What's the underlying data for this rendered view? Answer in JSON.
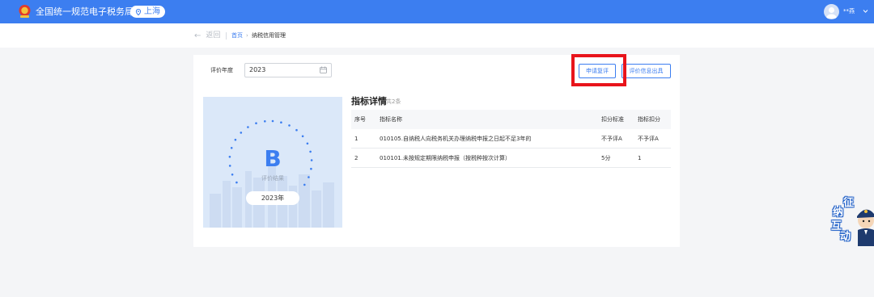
{
  "header": {
    "site_title": "全国统一规范电子税务局",
    "region": "上海",
    "user_name": "**燕",
    "brand_color": "#3c7ef0"
  },
  "breadcrumb": {
    "back_label": "返回",
    "home_label": "首页",
    "separator": "›",
    "current_label": "纳税信用管理"
  },
  "filter": {
    "year_label": "评价年度",
    "year_value": "2023"
  },
  "actions": {
    "apply_label": "申请复评",
    "issue_label": "评价信息出具",
    "highlight_color": "#e8141b"
  },
  "result": {
    "grade": "B",
    "grade_label": "评价结果",
    "year_pill": "2023年"
  },
  "details": {
    "title": "指标详情",
    "count_text": "共2条",
    "columns": [
      "序号",
      "指标名称",
      "扣分标准",
      "指标扣分"
    ],
    "rows": [
      [
        "1",
        "010105.自纳税人向税务机关办理纳税申报之日起不足3年的",
        "不予评A",
        "不予评A"
      ],
      [
        "2",
        "010101.未按规定期限纳税申报（按税种按次计算）",
        "5分",
        "1"
      ]
    ]
  },
  "mascot": {
    "chars": [
      "征",
      "纳",
      "互",
      "动"
    ]
  },
  "icons": [
    "emblem-icon",
    "location-pin-icon",
    "user-avatar-icon",
    "chevron-down-icon",
    "back-arrow-icon",
    "calendar-icon"
  ]
}
